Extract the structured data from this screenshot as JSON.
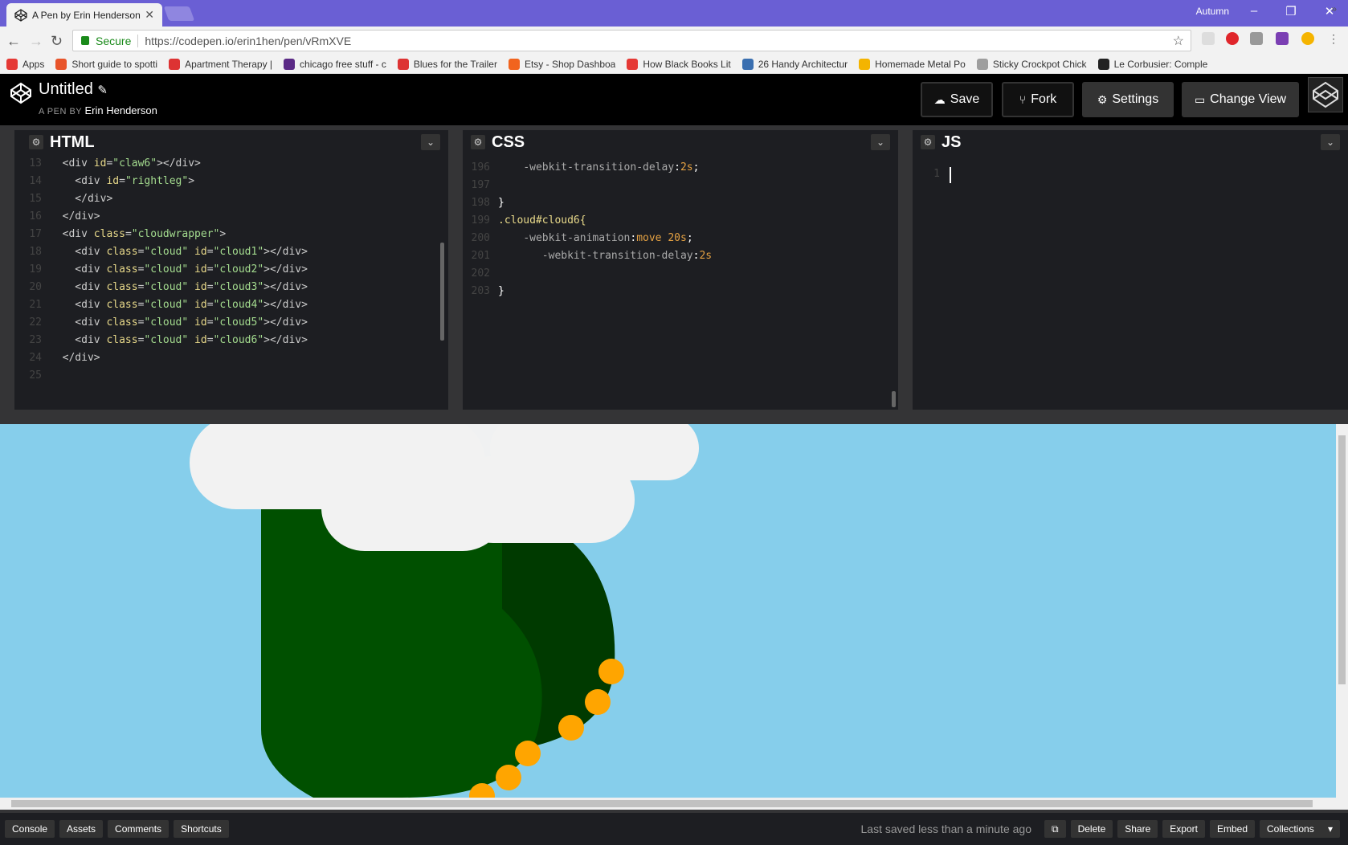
{
  "browser": {
    "tab_title": "A Pen by Erin Henderson",
    "tab_close": "✕",
    "profile_name": "Autumn",
    "window_controls": [
      "–",
      "❐",
      "✕"
    ],
    "secure_label": "Secure",
    "url": "https://codepen.io/erin1hen/pen/vRmXVE",
    "bookmarks": [
      {
        "label": "Apps",
        "color": "#e53935"
      },
      {
        "label": "Short guide to spotti",
        "color": "#e8542a"
      },
      {
        "label": "Apartment Therapy |",
        "color": "#d33"
      },
      {
        "label": "chicago free stuff - c",
        "color": "#5b2a86"
      },
      {
        "label": "Blues for the Trailer",
        "color": "#d33"
      },
      {
        "label": "Etsy - Shop Dashboa",
        "color": "#f1641e"
      },
      {
        "label": "How Black Books Lit",
        "color": "#e53935"
      },
      {
        "label": "26 Handy Architectur",
        "color": "#3a6fb0"
      },
      {
        "label": "Homemade Metal Po",
        "color": "#f4b400"
      },
      {
        "label": "Sticky Crockpot Chick",
        "color": "#9e9e9e"
      },
      {
        "label": "Le Corbusier: Comple",
        "color": "#222"
      }
    ],
    "bookmarks_more": "»"
  },
  "header": {
    "title": "Untitled",
    "edit_icon": "✎",
    "subtitle_prefix": "A PEN BY",
    "author": "Erin Henderson",
    "buttons": {
      "save": "Save",
      "fork": "Fork",
      "settings": "Settings",
      "change_view": "Change View"
    }
  },
  "editors": {
    "html": {
      "name": "HTML",
      "lines": [
        {
          "n": "13",
          "code": "  <div id=\"claw6\"></div>"
        },
        {
          "n": "14",
          "code": "    <div id=\"rightleg\">"
        },
        {
          "n": "15",
          "code": "    </div>"
        },
        {
          "n": "16",
          "code": "  </div>"
        },
        {
          "n": "17",
          "code": "  <div class=\"cloudwrapper\">"
        },
        {
          "n": "18",
          "code": "    <div class=\"cloud\" id=\"cloud1\"></div>"
        },
        {
          "n": "19",
          "code": "    <div class=\"cloud\" id=\"cloud2\"></div>"
        },
        {
          "n": "20",
          "code": "    <div class=\"cloud\" id=\"cloud3\"></div>"
        },
        {
          "n": "21",
          "code": "    <div class=\"cloud\" id=\"cloud4\"></div>"
        },
        {
          "n": "22",
          "code": "    <div class=\"cloud\" id=\"cloud5\"></div>"
        },
        {
          "n": "23",
          "code": "    <div class=\"cloud\" id=\"cloud6\"></div>"
        },
        {
          "n": "24",
          "code": "  </div>"
        },
        {
          "n": "25",
          "code": ""
        }
      ]
    },
    "css": {
      "name": "CSS",
      "lines": [
        {
          "n": "196",
          "code": "    -webkit-transition-delay:2s;"
        },
        {
          "n": "197",
          "code": ""
        },
        {
          "n": "198",
          "code": "}"
        },
        {
          "n": "199",
          "code": ".cloud#cloud6{"
        },
        {
          "n": "200",
          "code": "    -webkit-animation:move 20s;"
        },
        {
          "n": "201",
          "code": "       -webkit-transition-delay:2s"
        },
        {
          "n": "202",
          "code": ""
        },
        {
          "n": "203",
          "code": "}"
        }
      ]
    },
    "js": {
      "name": "JS",
      "lines": [
        {
          "n": "1",
          "code": ""
        }
      ]
    }
  },
  "footer": {
    "left_buttons": [
      "Console",
      "Assets",
      "Comments",
      "Shortcuts"
    ],
    "status": "Last saved less than a minute ago",
    "right_buttons": [
      "Delete",
      "Share",
      "Export",
      "Embed",
      "Collections"
    ],
    "collections_caret": "▾"
  },
  "colors": {
    "sky": "#86ceeb",
    "cloud": "#f2f2f2",
    "leg_light": "#005000",
    "leg_dark": "#003a00",
    "claw": "#ffa500"
  }
}
